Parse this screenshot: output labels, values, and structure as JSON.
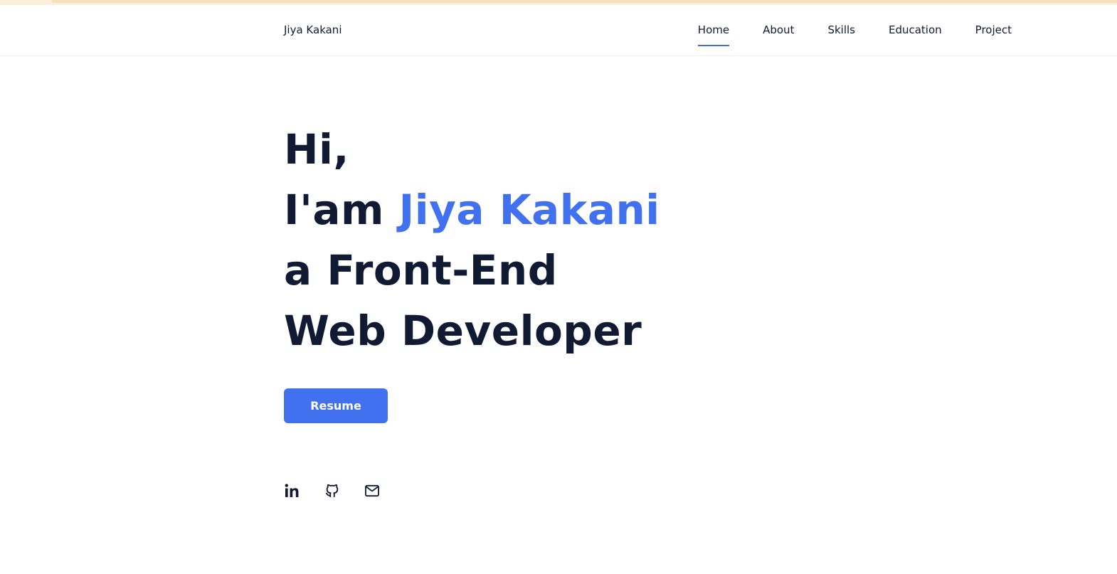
{
  "header": {
    "brand": "Jiya Kakani",
    "nav": [
      {
        "label": "Home",
        "active": true
      },
      {
        "label": "About",
        "active": false
      },
      {
        "label": "Skills",
        "active": false
      },
      {
        "label": "Education",
        "active": false
      },
      {
        "label": "Project",
        "active": false
      }
    ]
  },
  "hero": {
    "line1": "Hi,",
    "line2_prefix": "I'am ",
    "line2_name": "Jiya Kakani",
    "line3": "a Front-End",
    "line4": "Web Developer",
    "resume_label": "Resume"
  },
  "socials": [
    {
      "icon": "linkedin-icon"
    },
    {
      "icon": "github-icon"
    },
    {
      "icon": "mail-icon"
    }
  ],
  "colors": {
    "accent": "#4271ef",
    "text": "#111a33",
    "background": "#ffffff"
  }
}
